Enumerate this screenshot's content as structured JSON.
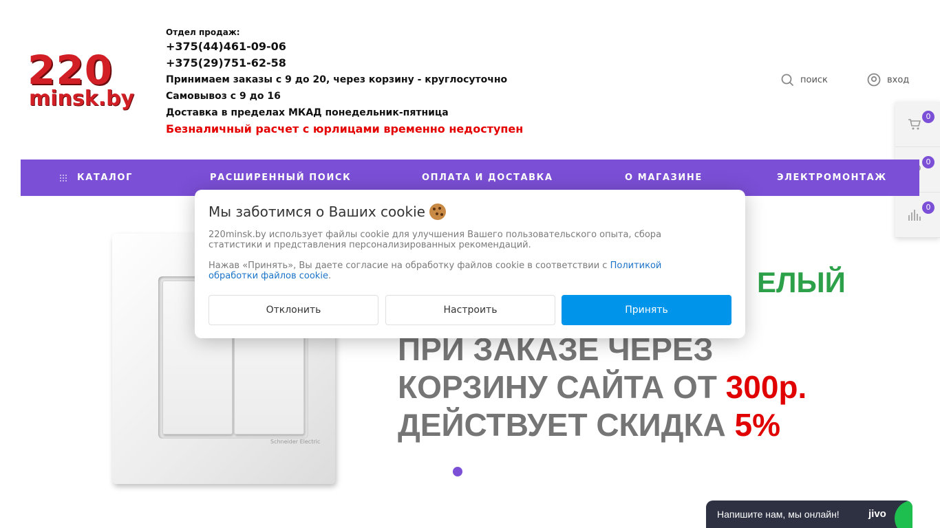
{
  "logo": {
    "line1": "220",
    "line2": "minsk.by"
  },
  "contacts": {
    "dept_label": "Отдел продаж:",
    "phone1": "+375(44)461-09-06",
    "phone2": "+375(29)751-62-58",
    "hours": "Принимаем заказы с 9 до 20, через корзину - круглосуточно",
    "pickup": "Самовывоз с 9 до 16",
    "delivery": "Доставка в пределах МКАД понедельник-пятница",
    "warning": "Безналичный расчет с юрлицами временно недоступен"
  },
  "header": {
    "search_label": "поиск",
    "login_label": "вход"
  },
  "side_panel": {
    "cart_count": "0",
    "favorites_count": "0",
    "compare_count": "0"
  },
  "nav": {
    "items": [
      "КАТАЛОГ",
      "РАСШИРЕННЫЙ ПОИСК",
      "ОПЛАТА И ДОСТАВКА",
      "О МАГАЗИНЕ",
      "ЭЛЕКТРОМОНТАЖ"
    ]
  },
  "banner": {
    "partial_green": "ЕЛЫЙ",
    "line1": "ПРИ ЗАКАЗЕ ЧЕРЕЗ",
    "line2_prefix": "КОРЗИНУ САЙТА ОТ ",
    "line2_highlight": "300р.",
    "line3_prefix": "ДЕЙСТВУЕТ СКИДКА ",
    "line3_highlight": "5%",
    "switch_brand": "Schneider Electric"
  },
  "cookie": {
    "title": "Мы заботимся о Ваших cookie",
    "text1": "220minsk.by использует файлы cookie для улучшения Вашего пользовательского опыта, сбора статистики и представления персонализированных рекомендаций.",
    "text2_prefix": "Нажав «Принять», Вы даете согласие на обработку файлов cookie в соответствии с ",
    "text2_link": "Политикой обработки файлов cookie",
    "text2_suffix": ".",
    "decline": "Отклонить",
    "configure": "Настроить",
    "accept": "Принять"
  },
  "chat": {
    "text": "Напишите нам, мы онлайн!",
    "brand": "jivo"
  },
  "colors": {
    "accent": "#7b4fd6",
    "warning": "#e50000",
    "accept": "#0095eb"
  }
}
